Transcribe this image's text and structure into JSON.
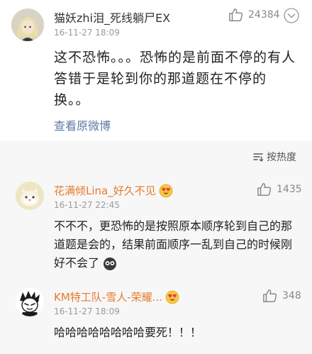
{
  "comment_main": {
    "username": "猫妖zhi泪_死线躺尸EX",
    "timestamp": "16-11-27 18:09",
    "like_count": "24384",
    "text": "这不恐怖。。。恐怖的是前面不停的有人答错于是轮到你的那道题在不停的换。。",
    "view_original_label": "查看原微博"
  },
  "sort": {
    "label": "按热度"
  },
  "replies": [
    {
      "username": "花满倾Lina_好久不见",
      "timestamp": "16-11-27 22:45",
      "like_count": "1435",
      "text": "不不不，更恐怖的是按照原本顺序轮到自己的那道题是会的，结果前面顺序一乱到自己的时候刚好不会了"
    },
    {
      "username": "KM特工队-雪人-荣耀...",
      "timestamp": "16-11-27 18:09",
      "like_count": "348",
      "text": "哈哈哈哈哈哈哈哈要死！！！"
    }
  ],
  "icons": {
    "like": "thumbs-up-icon",
    "dropdown": "chevron-down-icon",
    "sort": "sort-icon",
    "emoji": "heart-eyes-emoji-icon",
    "inline_emoji": "speechless-emoji-icon"
  },
  "colors": {
    "link": "#5b7aa8",
    "username_highlight": "#e57a2c",
    "secondary": "#9a9a9a",
    "reply_background": "#f7f7f7"
  }
}
